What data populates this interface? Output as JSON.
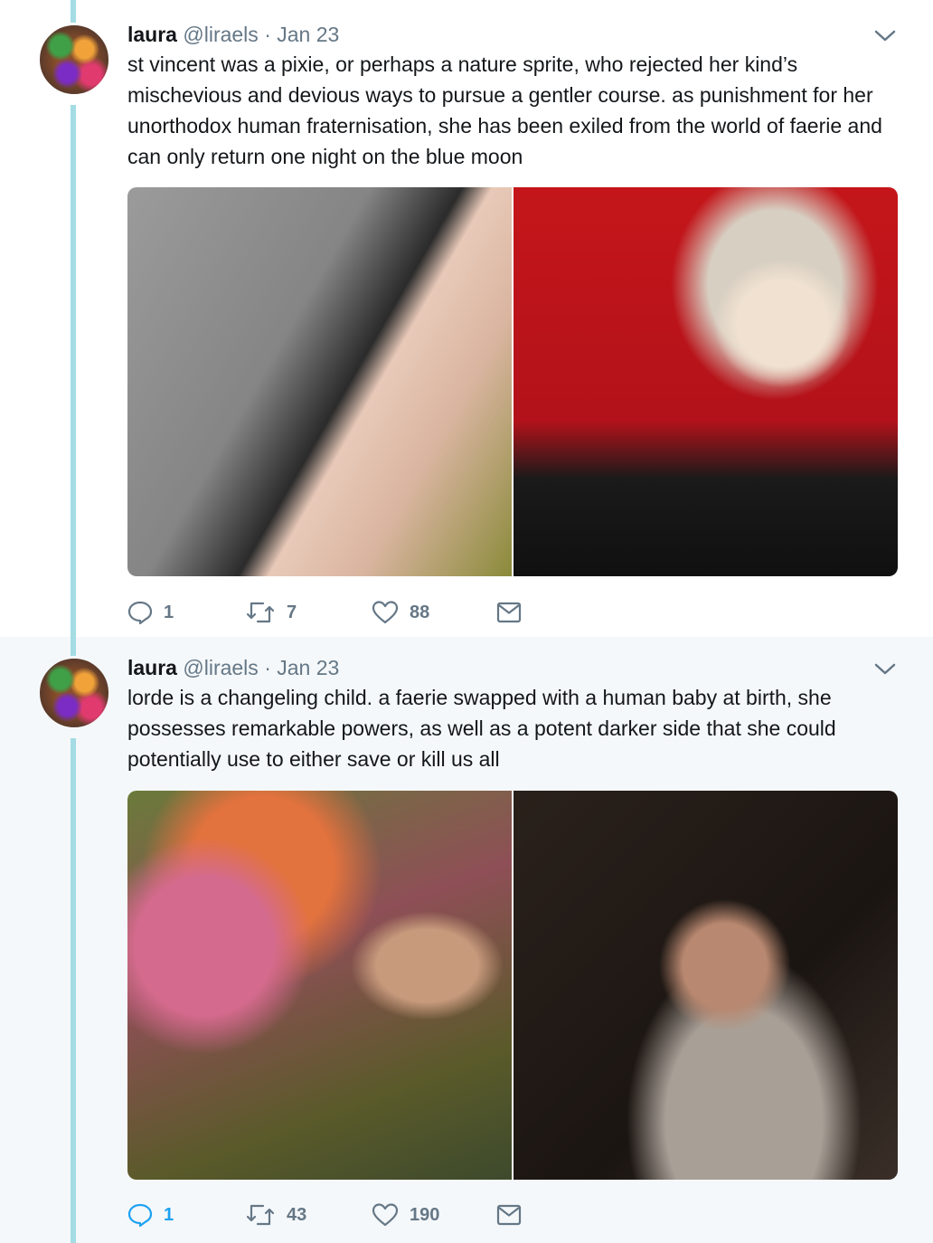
{
  "tweets": [
    {
      "author_name": "laura",
      "author_handle": "@liraels",
      "separator": "·",
      "date": "Jan 23",
      "text": "st vincent was a pixie, or perhaps a nature sprite, who rejected her kind’s mischevious and devious ways to pursue a gentler course. as punishment for her unorthodox human fraternisation, she has been exiled from the world of faerie and can only return one night on the blue moon",
      "actions": {
        "replies": "1",
        "retweets": "7",
        "likes": "88"
      },
      "icons": [
        "reply-icon",
        "retweet-icon",
        "like-icon",
        "message-icon",
        "chevron-down-icon"
      ]
    },
    {
      "author_name": "laura",
      "author_handle": "@liraels",
      "separator": "·",
      "date": "Jan 23",
      "text": "lorde is a changeling child. a faerie swapped with a human baby at birth, she possesses remarkable powers, as well as a potent darker side that she could potentially use to either save or kill us all",
      "actions": {
        "replies": "1",
        "retweets": "43",
        "likes": "190"
      },
      "icons": [
        "reply-icon",
        "retweet-icon",
        "like-icon",
        "message-icon",
        "chevron-down-icon"
      ]
    }
  ],
  "colors": {
    "thread_line": "#a4dce4",
    "icon_gray": "#657786",
    "reply_active": "#1da1f2",
    "second_bg": "#f5f8fa"
  }
}
